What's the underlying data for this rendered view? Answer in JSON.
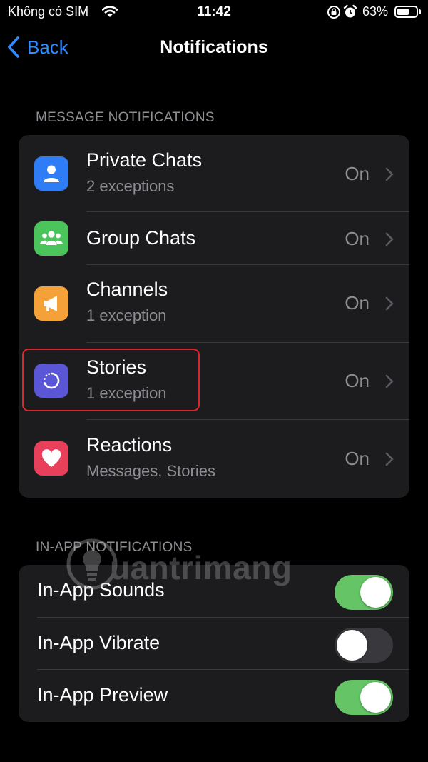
{
  "status_bar": {
    "carrier": "Không có SIM",
    "time": "11:42",
    "battery_percent": "63%",
    "battery_level": 0.63
  },
  "nav": {
    "back_label": "Back",
    "title": "Notifications"
  },
  "message_section": {
    "header": "MESSAGE NOTIFICATIONS",
    "rows": [
      {
        "title": "Private Chats",
        "subtitle": "2 exceptions",
        "value": "On",
        "icon": "person-icon",
        "color": "#2f7df6"
      },
      {
        "title": "Group Chats",
        "subtitle": "",
        "value": "On",
        "icon": "group-icon",
        "color": "#4cc45c"
      },
      {
        "title": "Channels",
        "subtitle": "1 exception",
        "value": "On",
        "icon": "megaphone-icon",
        "color": "#f4a139"
      },
      {
        "title": "Stories",
        "subtitle": "1 exception",
        "value": "On",
        "icon": "story-circle-icon",
        "color": "#5b56d6"
      },
      {
        "title": "Reactions",
        "subtitle": "Messages, Stories",
        "value": "On",
        "icon": "heart-icon",
        "color": "#e8405a"
      }
    ]
  },
  "inapp_section": {
    "header": "IN-APP NOTIFICATIONS",
    "rows": [
      {
        "title": "In-App Sounds",
        "on": true
      },
      {
        "title": "In-App Vibrate",
        "on": false
      },
      {
        "title": "In-App Preview",
        "on": true
      }
    ]
  },
  "colors": {
    "accent": "#2f8bff",
    "toggle_on": "#65c466",
    "toggle_off": "#39393d",
    "highlight": "#e0242c"
  },
  "watermark": {
    "text": "uantrimang",
    "icon": "lightbulb-icon"
  }
}
